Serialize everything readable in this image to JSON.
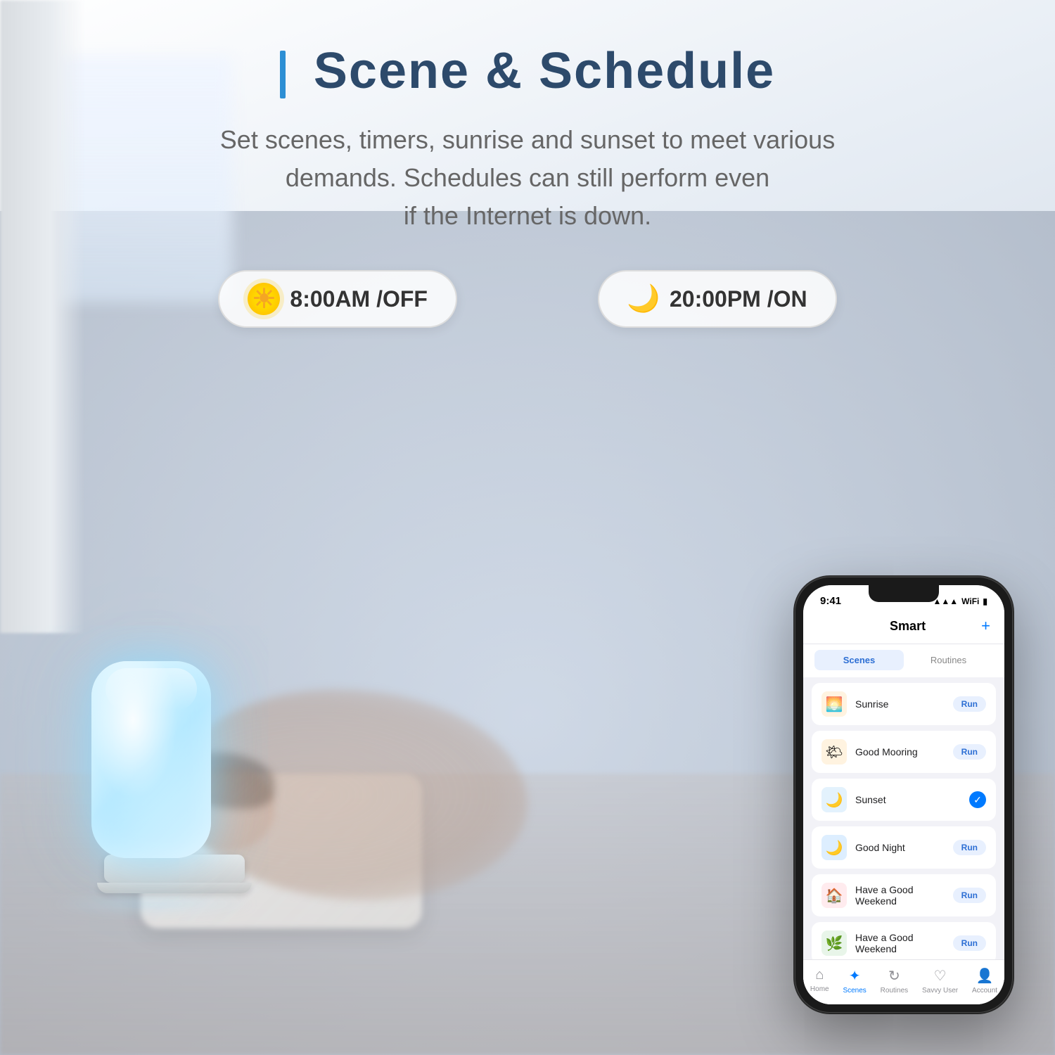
{
  "header": {
    "title": "Scene & Schedule",
    "title_bar": "|",
    "subtitle": "Set scenes, timers, sunrise and sunset to meet various\ndemands. Schedules can still perform even\nif the Internet is down."
  },
  "schedules": [
    {
      "icon_type": "sun",
      "time": "8:00AM",
      "status": "OFF",
      "label": "8:00AM /OFF"
    },
    {
      "icon_type": "moon-cloud",
      "time": "20:00PM",
      "status": "ON",
      "label": "20:00PM /ON"
    }
  ],
  "phone": {
    "status_time": "9:41",
    "signal": "▲▲▲",
    "wifi": "WiFi",
    "battery": "🔋",
    "app_title": "Smart",
    "add_icon": "+",
    "tabs": [
      "Scenes",
      "Routines"
    ],
    "active_tab": 0,
    "scenes": [
      {
        "name": "Sunrise",
        "icon": "🌅",
        "icon_class": "scene-icon-sunrise",
        "action": "Run",
        "active": false
      },
      {
        "name": "Good Mooring",
        "icon": "🌤",
        "icon_class": "scene-icon-morning",
        "action": "Run",
        "active": false
      },
      {
        "name": "Sunset",
        "icon": "🌙",
        "icon_class": "scene-icon-sunset",
        "action": "✓",
        "active": true
      },
      {
        "name": "Good Night",
        "icon": "🌙",
        "icon_class": "scene-icon-night",
        "action": "Run",
        "active": false
      },
      {
        "name": "Have a Good Weekend",
        "icon": "🏠",
        "icon_class": "scene-icon-weekend-red",
        "action": "Run",
        "active": false
      },
      {
        "name": "Have a Good Weekend",
        "icon": "🌿",
        "icon_class": "scene-icon-weekend-green",
        "action": "Run",
        "active": false
      }
    ],
    "nav": [
      {
        "icon": "⌂",
        "label": "Home",
        "active": false
      },
      {
        "icon": "✦",
        "label": "Scenes",
        "active": true
      },
      {
        "icon": "↻",
        "label": "Routines",
        "active": false
      },
      {
        "icon": "♡",
        "label": "Savvy User",
        "active": false
      },
      {
        "icon": "👤",
        "label": "Account",
        "active": false
      }
    ]
  }
}
